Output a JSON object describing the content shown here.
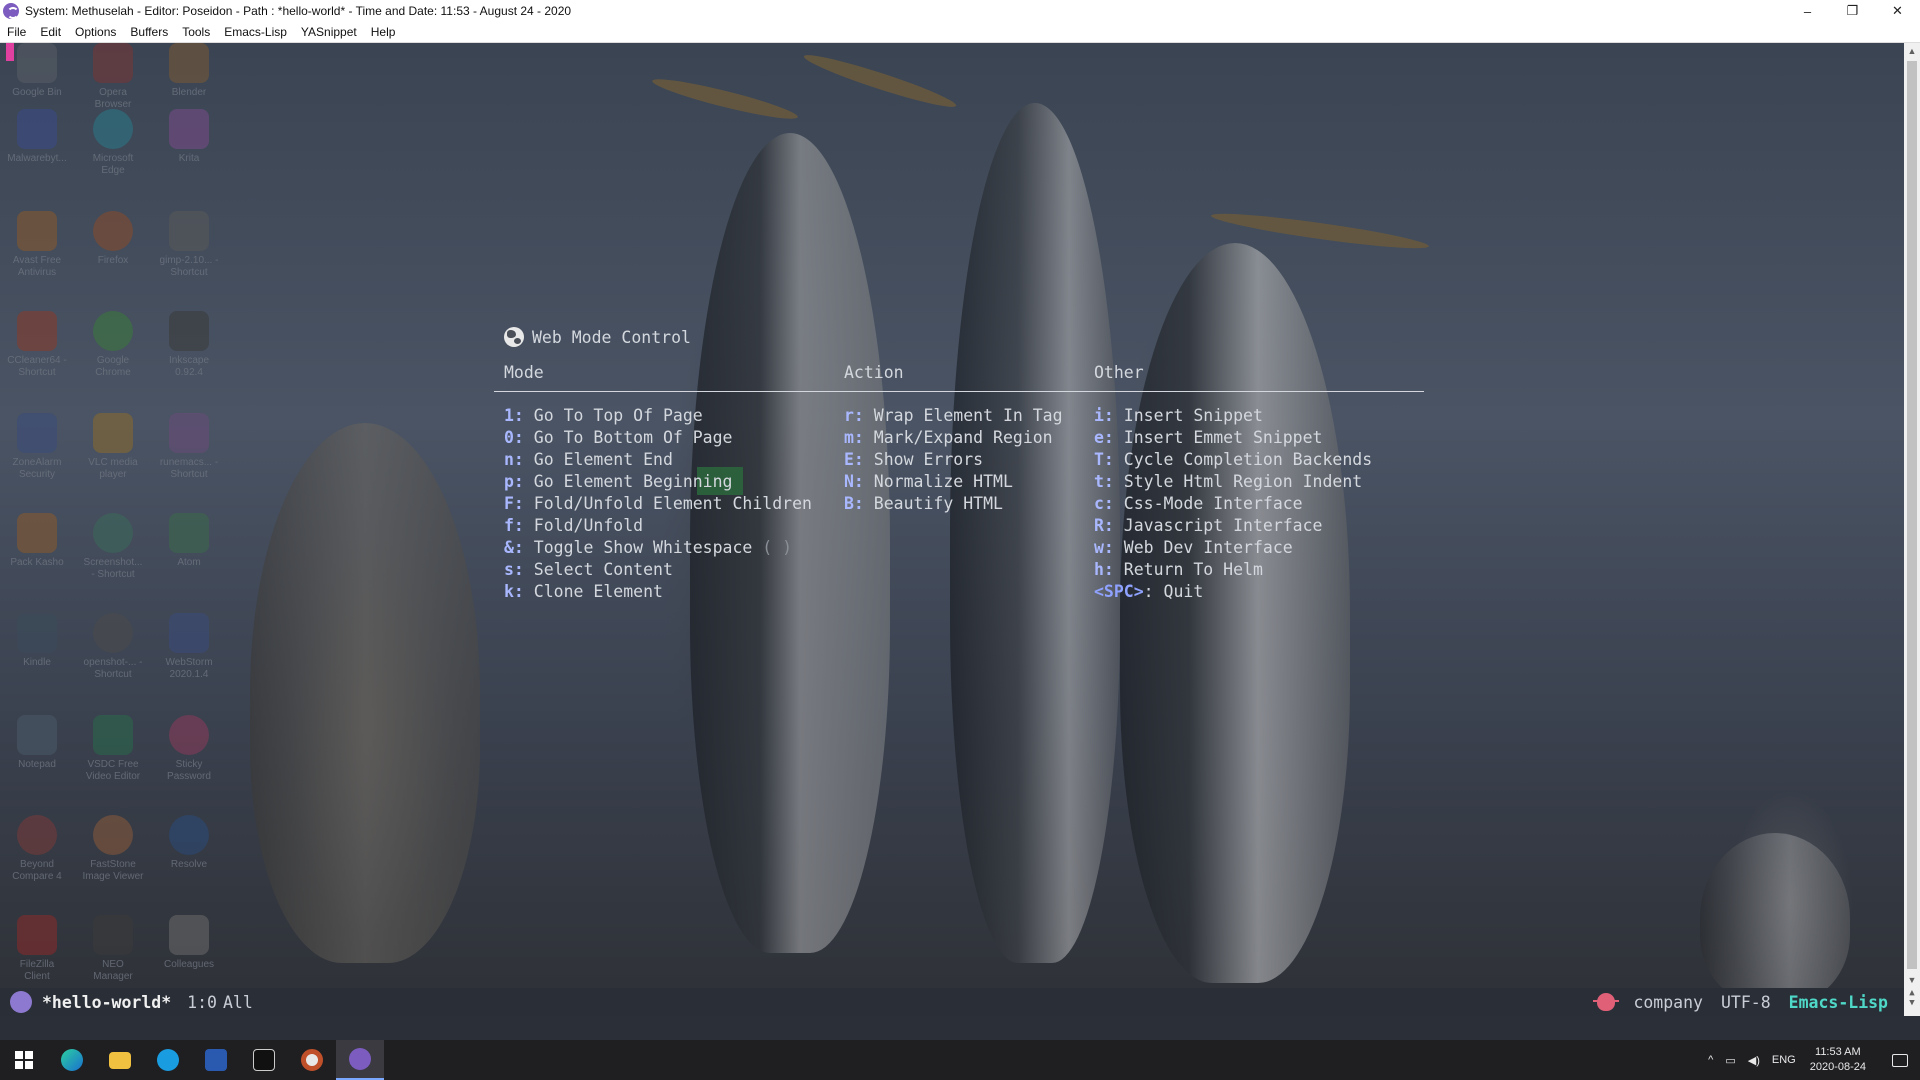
{
  "window": {
    "title": "System: Methuselah - Editor: Poseidon - Path : *hello-world* - Time and Date: 11:53 - August 24 - 2020",
    "minimize": "–",
    "maximize": "❐",
    "close": "✕"
  },
  "menubar": [
    "File",
    "Edit",
    "Options",
    "Buffers",
    "Tools",
    "Emacs-Lisp",
    "YASnippet",
    "Help"
  ],
  "desktop_icons": [
    {
      "label": "Google Bin"
    },
    {
      "label": "Opera Browser"
    },
    {
      "label": "Blender"
    },
    {
      "label": "Malwarebyt..."
    },
    {
      "label": "Microsoft Edge"
    },
    {
      "label": "Krita"
    },
    {
      "label": "Avast Free Antivirus"
    },
    {
      "label": "Firefox"
    },
    {
      "label": "gimp-2.10... - Shortcut"
    },
    {
      "label": "CCleaner64 - Shortcut"
    },
    {
      "label": "Google Chrome"
    },
    {
      "label": "Inkscape 0.92.4"
    },
    {
      "label": "ZoneAlarm Security"
    },
    {
      "label": "VLC media player"
    },
    {
      "label": "runemacs... - Shortcut"
    },
    {
      "label": "Pack Kasho"
    },
    {
      "label": "Screenshot... - Shortcut"
    },
    {
      "label": "Atom"
    },
    {
      "label": "Kindle"
    },
    {
      "label": "openshot-... - Shortcut"
    },
    {
      "label": "WebStorm 2020.1.4"
    },
    {
      "label": "Notepad"
    },
    {
      "label": "VSDC Free Video Editor"
    },
    {
      "label": "Sticky Password"
    },
    {
      "label": "Beyond Compare 4"
    },
    {
      "label": "FastStone Image Viewer"
    },
    {
      "label": "Resolve"
    },
    {
      "label": "FileZilla Client"
    },
    {
      "label": "NEO Manager"
    },
    {
      "label": "Colleagues"
    }
  ],
  "hydra": {
    "title": "Web Mode Control",
    "columns": {
      "mode": {
        "header": "Mode",
        "rows": [
          {
            "key": "1:",
            "label": " Go To Top Of Page"
          },
          {
            "key": "0:",
            "label": " Go To Bottom Of Page"
          },
          {
            "key": "n:",
            "label": " Go Element End"
          },
          {
            "key": "p:",
            "label": " Go Element Beginning"
          },
          {
            "key": "F:",
            "label": " Fold/Unfold Element Children"
          },
          {
            "key": "f:",
            "label": " Fold/Unfold"
          },
          {
            "key": "&:",
            "label": " Toggle Show Whitespace",
            "hint": " ( )"
          },
          {
            "key": "s:",
            "label": " Select Content"
          },
          {
            "key": "k:",
            "label": " Clone Element"
          }
        ]
      },
      "action": {
        "header": "Action",
        "rows": [
          {
            "key": "r:",
            "label": " Wrap Element In Tag"
          },
          {
            "key": "m:",
            "label": " Mark/Expand Region"
          },
          {
            "key": "E:",
            "label": " Show Errors"
          },
          {
            "key": "N:",
            "label": " Normalize HTML"
          },
          {
            "key": "B:",
            "label": " Beautify HTML"
          }
        ]
      },
      "other": {
        "header": "Other",
        "rows": [
          {
            "key": "i:",
            "label": " Insert Snippet"
          },
          {
            "key": "e:",
            "label": " Insert Emmet Snippet"
          },
          {
            "key": "T:",
            "label": " Cycle Completion Backends"
          },
          {
            "key": "t:",
            "label": " Style Html Region Indent"
          },
          {
            "key": "c:",
            "label": " Css-Mode Interface"
          },
          {
            "key": "R:",
            "label": " Javascript Interface"
          },
          {
            "key": "w:",
            "label": " Web Dev Interface"
          },
          {
            "key": "h:",
            "label": " Return To Helm"
          },
          {
            "key": "<SPC>",
            "label": ": Quit"
          }
        ]
      }
    }
  },
  "modeline": {
    "buffer": "*hello-world*",
    "position": "1:0",
    "scroll": "All",
    "company": "company",
    "encoding": "UTF-8",
    "major_mode": "Emacs-Lisp"
  },
  "taskbar": {
    "apps": [
      "windows-start",
      "edge",
      "file-explorer",
      "skype",
      "powershell",
      "terminal",
      "ubuntu",
      "emacs"
    ],
    "tray_language": "ENG",
    "time": "11:53 AM",
    "date": "2020-08-24"
  }
}
